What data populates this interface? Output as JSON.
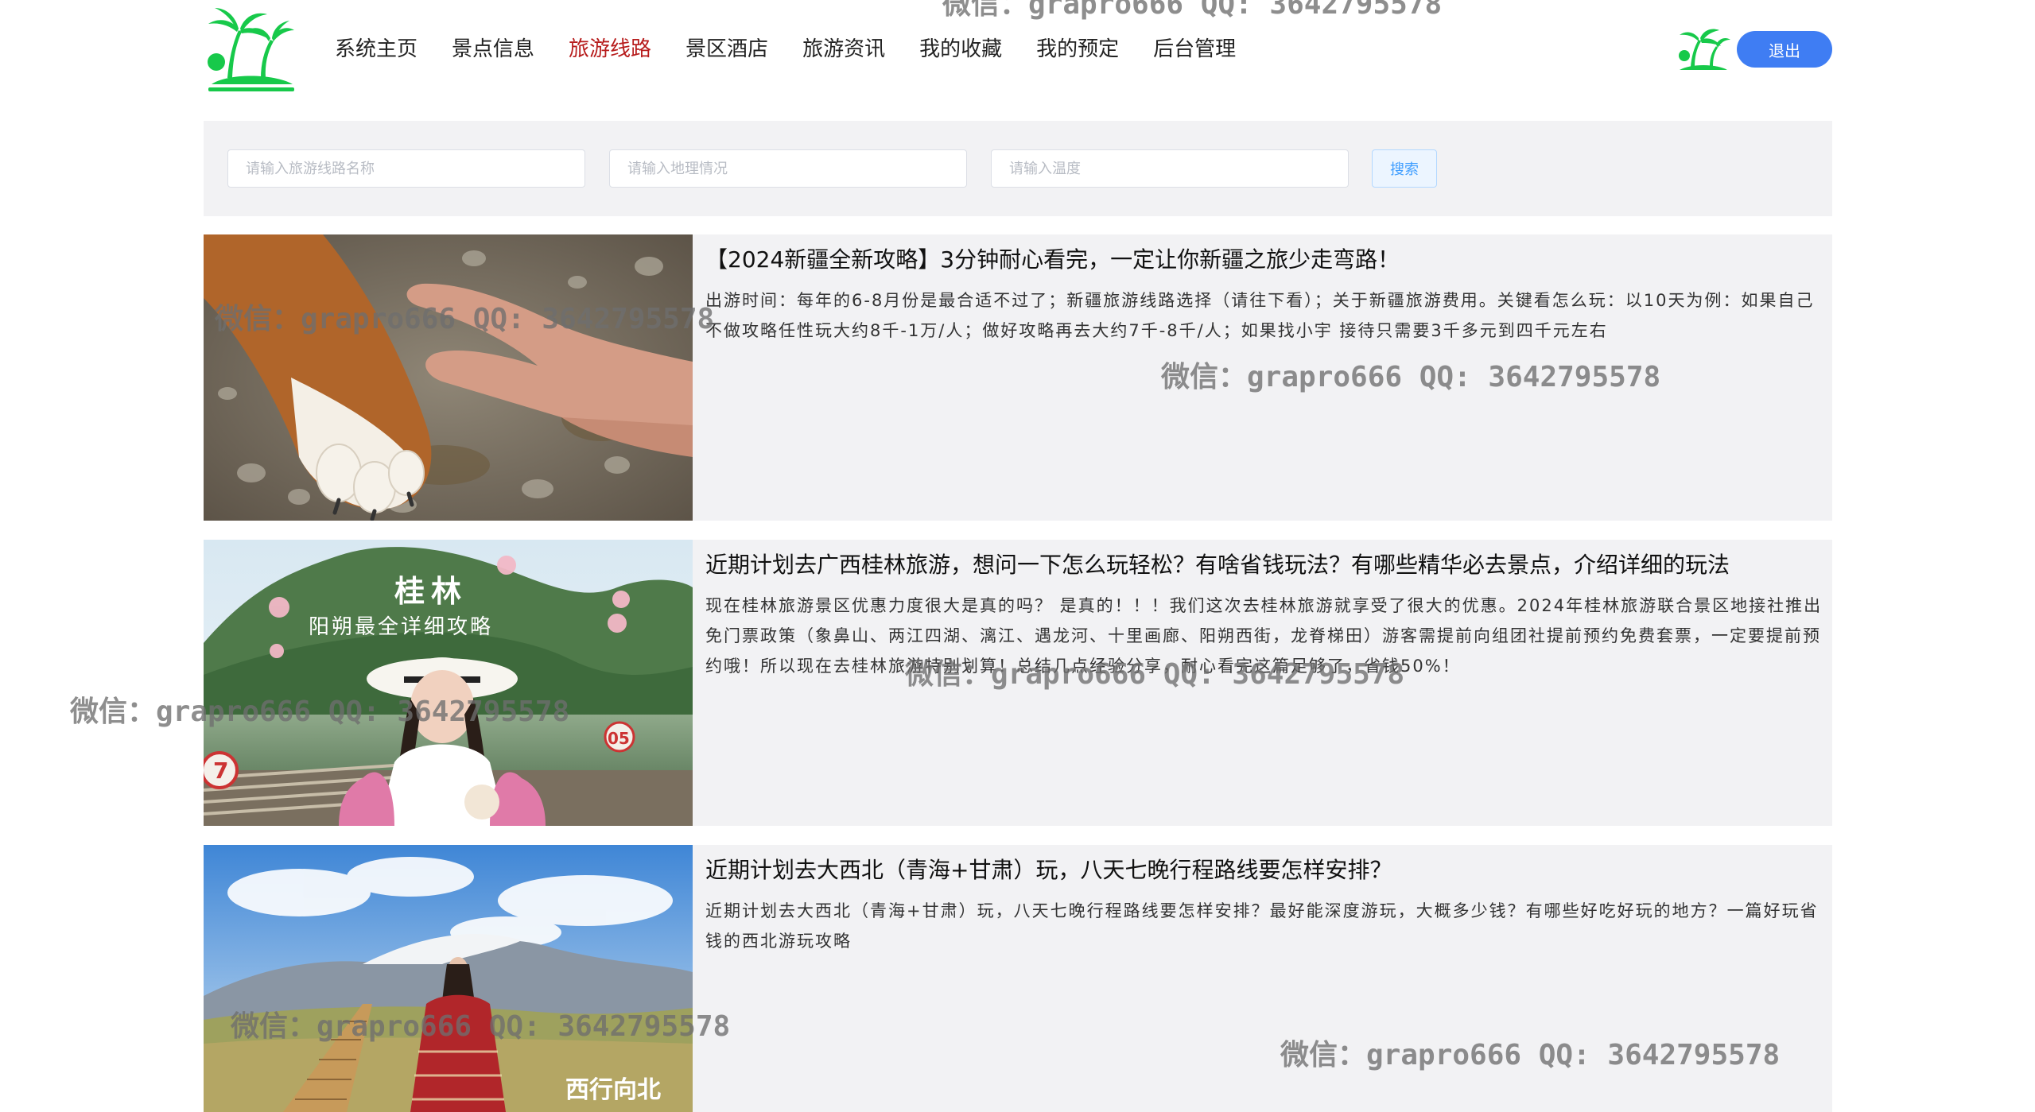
{
  "header": {
    "nav": [
      {
        "label": "系统主页",
        "active": false
      },
      {
        "label": "景点信息",
        "active": false
      },
      {
        "label": "旅游线路",
        "active": true
      },
      {
        "label": "景区酒店",
        "active": false
      },
      {
        "label": "旅游资讯",
        "active": false
      },
      {
        "label": "我的收藏",
        "active": false
      },
      {
        "label": "我的预定",
        "active": false
      },
      {
        "label": "后台管理",
        "active": false
      }
    ],
    "logout_label": "退出",
    "logo_icon": "palm-tree-icon",
    "avatar_icon": "palm-tree-icon"
  },
  "search": {
    "route_name_placeholder": "请输入旅游线路名称",
    "geography_placeholder": "请输入地理情况",
    "temperature_placeholder": "请输入温度",
    "search_label": "搜索"
  },
  "routes": [
    {
      "title": "【2024新疆全新攻略】3分钟耐心看完，一定让你新疆之旅少走弯路！",
      "description": "出游时间：每年的6-8月份是最合适不过了；新疆旅游线路选择（请往下看）；关于新疆旅游费用。关键看怎么玩：以10天为例：如果自己不做攻略任性玩大约8千-1万/人；做好攻略再去大约7千-8千/人；如果找小宇 接待只需要3千多元到四千元左右",
      "image_overlay": ""
    },
    {
      "title": "近期计划去广西桂林旅游，想问一下怎么玩轻松？有啥省钱玩法？有哪些精华必去景点，介绍详细的玩法",
      "description": "现在桂林旅游景区优惠力度很大是真的吗？ 是真的！！！我们这次去桂林旅游就享受了很大的优惠。2024年桂林旅游联合景区地接社推出免门票政策（象鼻山、两江四湖、漓江、遇龙河、十里画廊、阳朔西街，龙脊梯田）游客需提前向组团社提前预约免费套票，一定要提前预约哦！所以现在去桂林旅游特别划算！总结几点经验分享，耐心看完这篇足够了，省钱50%！",
      "image_overlay_title": "桂林",
      "image_overlay_subtitle": "阳朔最全详细攻略",
      "image_badge_1": "7",
      "image_badge_2": "05"
    },
    {
      "title": "近期计划去大西北（青海+甘肃）玩，八天七晚行程路线要怎样安排？",
      "description": "近期计划去大西北（青海+甘肃）玩，八天七晚行程路线要怎样安排？最好能深度游玩，大概多少钱？有哪些好吃好玩的地方？一篇好玩省钱的西北游玩攻略",
      "image_overlay_title": "西行向北"
    }
  ],
  "watermark": "微信：grapro666 QQ: 3642795578",
  "colors": {
    "accent_nav": "#b71c1c",
    "logout_button": "#3f7df3",
    "panel_bg": "#f2f2f4",
    "logo_green": "#17c94a"
  }
}
